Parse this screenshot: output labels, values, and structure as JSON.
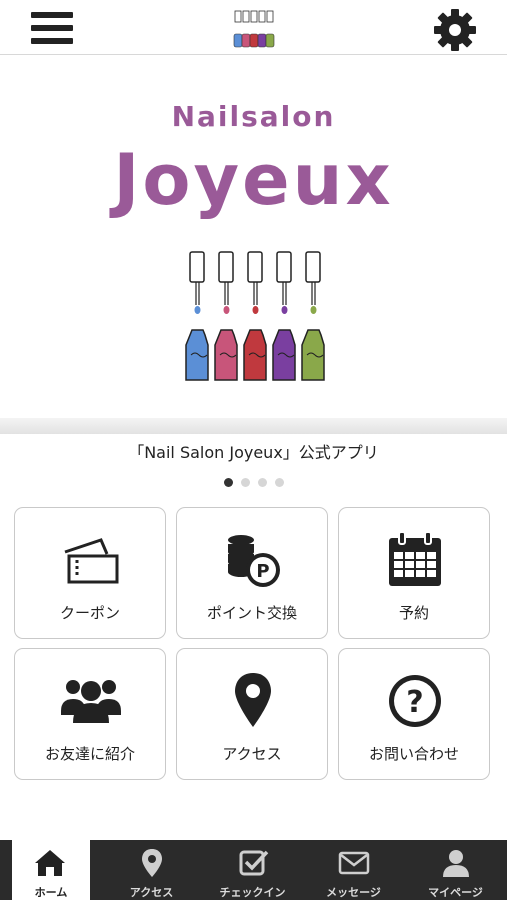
{
  "brand": {
    "subtitle": "Nailsalon",
    "title": "Joyeux"
  },
  "hero": {
    "caption": "「Nail Salon Joyeux」公式アプリ",
    "slides": 4,
    "active_slide": 1
  },
  "menu": [
    {
      "label": "クーポン",
      "icon": "ticket-icon"
    },
    {
      "label": "ポイント交換",
      "icon": "coins-point-icon"
    },
    {
      "label": "予約",
      "icon": "calendar-icon"
    },
    {
      "label": "お友達に紹介",
      "icon": "group-icon"
    },
    {
      "label": "アクセス",
      "icon": "map-pin-icon"
    },
    {
      "label": "お問い合わせ",
      "icon": "question-icon"
    }
  ],
  "bottom_nav": [
    {
      "label": "ホーム",
      "icon": "home-icon",
      "active": true
    },
    {
      "label": "アクセス",
      "icon": "map-pin-icon",
      "active": false
    },
    {
      "label": "チェックイン",
      "icon": "checkin-icon",
      "active": false
    },
    {
      "label": "メッセージ",
      "icon": "mail-icon",
      "active": false
    },
    {
      "label": "マイページ",
      "icon": "user-icon",
      "active": false
    }
  ],
  "colors": {
    "brand_purple": "#9a5a98",
    "bottle_blue": "#5b8fd6",
    "bottle_pink": "#c8557a",
    "bottle_red": "#c0393e",
    "bottle_purple": "#7a3fa0",
    "bottle_green": "#8aa84a",
    "nav_bg": "#2b2b2b"
  }
}
